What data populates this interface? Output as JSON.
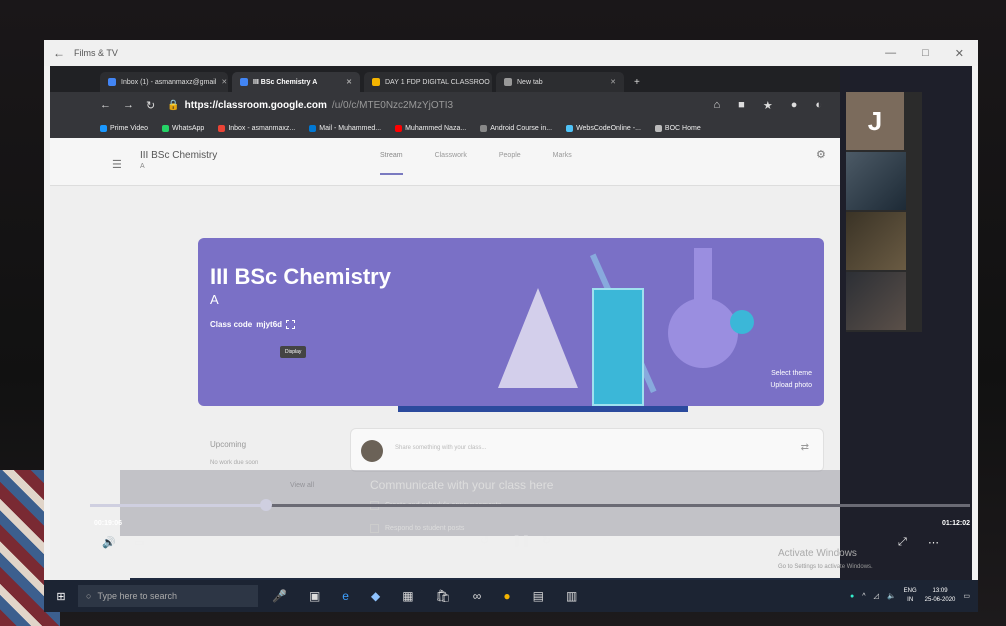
{
  "window": {
    "title": "Films & TV",
    "back": "←",
    "minimize": "—",
    "maximize": "□",
    "close": "✕"
  },
  "browser": {
    "tabs": [
      {
        "label": "Inbox (1) - asmanmaxz@gmail",
        "active": false
      },
      {
        "label": "III BSc Chemistry A",
        "active": true
      },
      {
        "label": "DAY 1 FDP DIGITAL CLASSROO",
        "active": false
      },
      {
        "label": "New tab",
        "active": false
      }
    ],
    "new_tab": "+",
    "url_host": "https://classroom.google.com",
    "url_path": "/u/0/c/MTE0Nzc2MzYjOTI3",
    "bookmarks": [
      {
        "label": "Prime Video",
        "color": "#1a98ff"
      },
      {
        "label": "WhatsApp",
        "color": "#25d366"
      },
      {
        "label": "Inbox - asmanmaxz...",
        "color": "#ea4335"
      },
      {
        "label": "Mail - Muhammed...",
        "color": "#0078d4"
      },
      {
        "label": "Muhammed Naza...",
        "color": "#ff0000"
      },
      {
        "label": "Android Course in...",
        "color": "#888888"
      },
      {
        "label": "WebsCodeOnline -...",
        "color": "#4fc3f7"
      },
      {
        "label": "BOC Home",
        "color": "#bbbbbb"
      }
    ]
  },
  "classroom": {
    "class_name": "III BSc Chemistry",
    "section": "A",
    "nav_tabs": [
      "Stream",
      "Classwork",
      "People",
      "Marks"
    ],
    "banner_title": "III BSc Chemistry",
    "banner_section": "A",
    "class_code_label": "Class code",
    "class_code": "mjyt6d",
    "tooltip": "Display",
    "select_theme": "Select theme",
    "upload_photo": "Upload photo",
    "upcoming_title": "Upcoming",
    "upcoming_note": "No work due soon",
    "view_all": "View all",
    "announce_placeholder": "Share something with your class...",
    "communicate": "Communicate with your class here",
    "option1": "Create and schedule announcements",
    "option2": "Respond to student posts"
  },
  "player": {
    "time_elapsed": "00:19:06",
    "time_total": "01:12:02",
    "progress": 0.2,
    "activate": "Activate Windows",
    "activate_sub": "Go to Settings to activate Windows."
  },
  "participants": {
    "initial": "J"
  },
  "taskbar": {
    "search_placeholder": "Type here to search",
    "lang": "ENG",
    "region": "IN",
    "time": "13:09",
    "date": "25-06-2020"
  }
}
